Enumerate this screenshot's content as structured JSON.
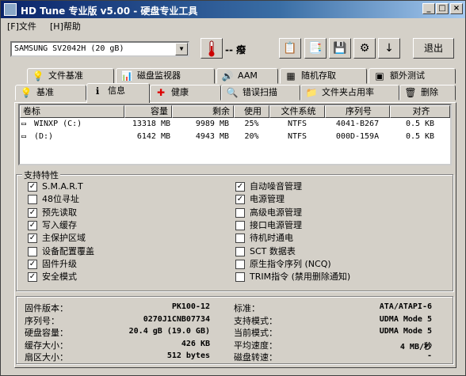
{
  "window": {
    "title": "HD Tune 专业版 v5.00 - 硬盘专业工具",
    "minimize": "_",
    "maximize": "□",
    "close": "×"
  },
  "menu": {
    "items": [
      {
        "label": "[F]文件"
      },
      {
        "label": "[H]帮助"
      }
    ]
  },
  "toolbar": {
    "drive": "SAMSUNG SV2042H (20 gB)",
    "temperature": "-- 癈",
    "exit_label": "退出"
  },
  "tabs": {
    "row1": [
      {
        "label": "文件基准",
        "icon": "doc-icon"
      },
      {
        "label": "磁盘监视器",
        "icon": "monitor-icon"
      },
      {
        "label": "AAM",
        "icon": "speaker-icon"
      },
      {
        "label": "随机存取",
        "icon": "random-icon"
      },
      {
        "label": "额外测试",
        "icon": "extra-icon"
      }
    ],
    "row2": [
      {
        "label": "基准",
        "icon": "benchmark-icon"
      },
      {
        "label": "信息",
        "icon": "info-icon"
      },
      {
        "label": "健康",
        "icon": "health-icon"
      },
      {
        "label": "错误扫描",
        "icon": "scan-icon"
      },
      {
        "label": "文件夹占用率",
        "icon": "folder-icon"
      },
      {
        "label": "删除",
        "icon": "trash-icon"
      }
    ],
    "active": "信息"
  },
  "volumes": {
    "columns": [
      "卷标",
      "容量",
      "剩余",
      "使用",
      "文件系统",
      "序列号",
      "对齐"
    ],
    "rows": [
      [
        "WINXP (C:)",
        "13318 MB",
        "9989 MB",
        "25%",
        "NTFS",
        "4041-B267",
        "0.5 KB"
      ],
      [
        "(D:)",
        "6142 MB",
        "4943 MB",
        "20%",
        "NTFS",
        "000D-159A",
        "0.5 KB"
      ]
    ]
  },
  "features": {
    "title": "支持特性",
    "left": [
      {
        "label": "S.M.A.R.T",
        "checked": true
      },
      {
        "label": "48位寻址",
        "checked": false
      },
      {
        "label": "预先读取",
        "checked": true
      },
      {
        "label": "写入缓存",
        "checked": true
      },
      {
        "label": "主保护区域",
        "checked": true
      },
      {
        "label": "设备配置覆盖",
        "checked": false
      },
      {
        "label": "固件升级",
        "checked": true
      },
      {
        "label": "安全模式",
        "checked": true
      }
    ],
    "right": [
      {
        "label": "自动噪音管理",
        "checked": true
      },
      {
        "label": "电源管理",
        "checked": true
      },
      {
        "label": "高级电源管理",
        "checked": false
      },
      {
        "label": "接口电源管理",
        "checked": false
      },
      {
        "label": "待机时通电",
        "checked": false
      },
      {
        "label": "SCT 数据表",
        "checked": false
      },
      {
        "label": "原生指令序列 (NCQ)",
        "checked": false
      },
      {
        "label": "TRIM指令 (禁用删除通知)",
        "checked": false
      }
    ]
  },
  "info": {
    "left": [
      {
        "label": "固件版本：",
        "value": "PK100-12"
      },
      {
        "label": "序列号：",
        "value": "0270J1CNB07734"
      },
      {
        "label": "硬盘容量：",
        "value": "20.4 gB (19.0 GB)"
      },
      {
        "label": "缓存大小：",
        "value": "426 KB"
      },
      {
        "label": "扇区大小：",
        "value": "512 bytes"
      }
    ],
    "right": [
      {
        "label": "标准：",
        "value": "ATA/ATAPI-6"
      },
      {
        "label": "支持模式：",
        "value": "UDMA Mode 5"
      },
      {
        "label": "当前模式：",
        "value": "UDMA Mode 5"
      },
      {
        "label": "平均速度：",
        "value": "4 MB/秒"
      },
      {
        "label": "磁盘转速：",
        "value": "-"
      }
    ]
  }
}
